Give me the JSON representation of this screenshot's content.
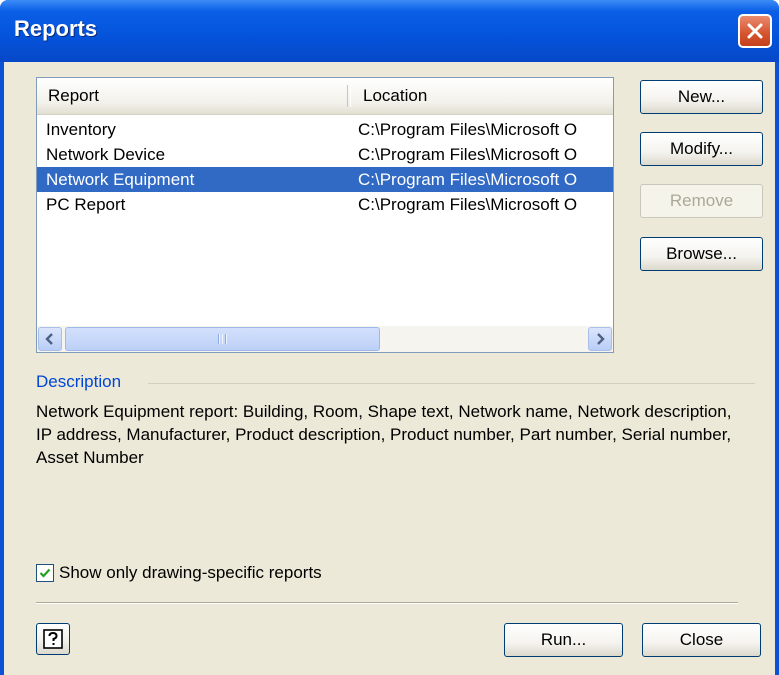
{
  "window": {
    "title": "Reports"
  },
  "list": {
    "columns": [
      "Report",
      "Location"
    ],
    "rows": [
      {
        "report": "Inventory",
        "location": "C:\\Program Files\\Microsoft O",
        "selected": false
      },
      {
        "report": "Network Device",
        "location": "C:\\Program Files\\Microsoft O",
        "selected": false
      },
      {
        "report": "Network Equipment",
        "location": "C:\\Program Files\\Microsoft O",
        "selected": true
      },
      {
        "report": "PC Report",
        "location": "C:\\Program Files\\Microsoft O",
        "selected": false
      }
    ]
  },
  "buttons": {
    "new": "New...",
    "modify": "Modify...",
    "remove": "Remove",
    "browse": "Browse...",
    "run": "Run...",
    "close": "Close"
  },
  "description": {
    "label": "Description",
    "text": "Network Equipment report: Building, Room, Shape text, Network name, Network description, IP address, Manufacturer, Product description, Product number, Part number, Serial number, Asset Number"
  },
  "checkbox": {
    "label": "Show only drawing-specific reports",
    "checked": true
  },
  "colors": {
    "selection": "#316ac5",
    "titlebar": "#0554dc",
    "description_label": "#0046d5"
  }
}
